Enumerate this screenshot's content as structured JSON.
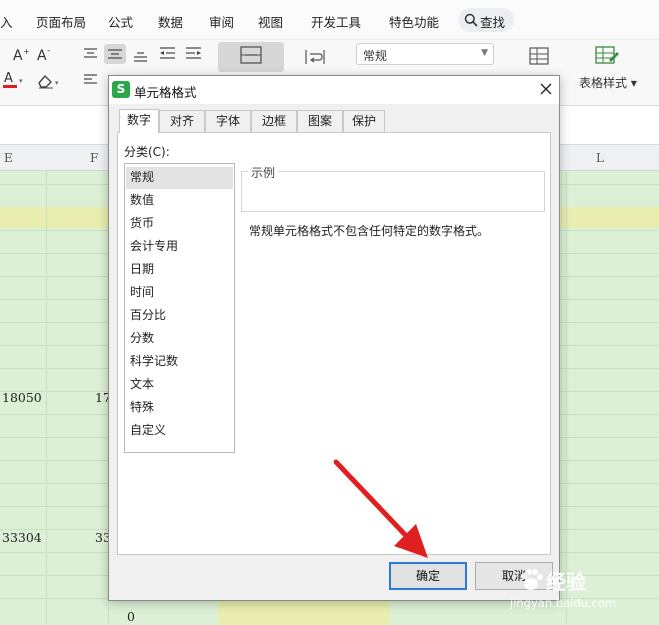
{
  "ribbon": {
    "menu": [
      "入",
      "页面布局",
      "公式",
      "数据",
      "审阅",
      "视图",
      "开发工具",
      "特色功能"
    ],
    "search_label": "查找",
    "number_format": "常规",
    "table_style_label": "表格样式"
  },
  "sheet": {
    "columns": [
      "E",
      "F",
      "L"
    ],
    "cells": [
      "18050",
      "17",
      "33304",
      "33",
      "0"
    ]
  },
  "dialog": {
    "logo_letter": "S",
    "title": "单元格格式",
    "tabs": [
      "数字",
      "对齐",
      "字体",
      "边框",
      "图案",
      "保护"
    ],
    "active_tab": "数字",
    "category_label": "分类(C):",
    "categories": [
      "常规",
      "数值",
      "货币",
      "会计专用",
      "日期",
      "时间",
      "百分比",
      "分数",
      "科学记数",
      "文本",
      "特殊",
      "自定义"
    ],
    "selected_category": "常规",
    "sample_label": "示例",
    "description": "常规单元格格式不包含任何特定的数字格式。",
    "ok_label": "确定",
    "cancel_label": "取消"
  },
  "watermark": {
    "brand": "经验",
    "url": "jingyan.baidu.com"
  },
  "colors": {
    "sheet_green": "#dcf0d6",
    "highlight_yellow": "#e9eeb0",
    "annotation_arrow": "#e02020",
    "primary_button_border": "#3078d8"
  }
}
